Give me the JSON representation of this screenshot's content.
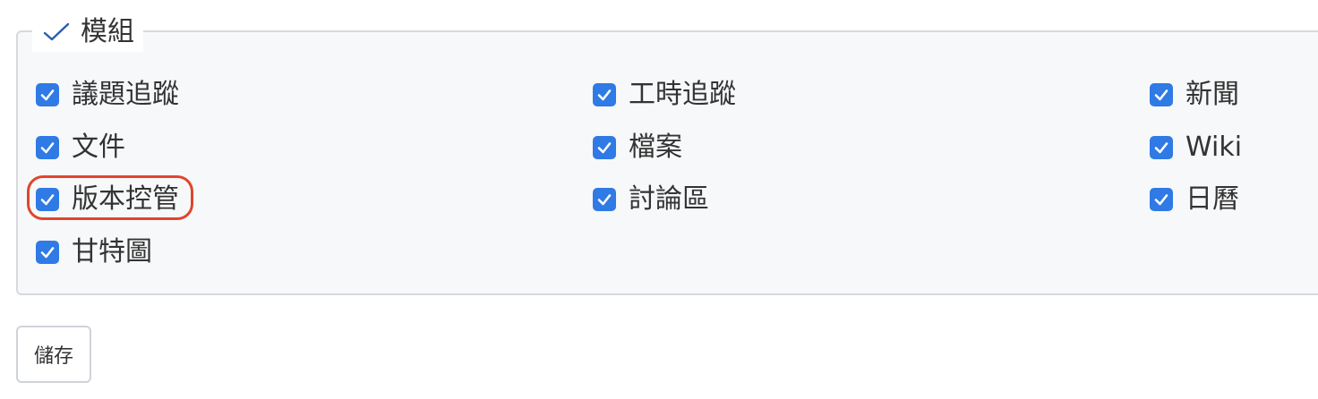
{
  "fieldset": {
    "legend": "模組",
    "options": [
      {
        "label": "議題追蹤",
        "checked": true
      },
      {
        "label": "工時追蹤",
        "checked": true
      },
      {
        "label": "新聞",
        "checked": true
      },
      {
        "label": "文件",
        "checked": true
      },
      {
        "label": "檔案",
        "checked": true
      },
      {
        "label": "Wiki",
        "checked": true
      },
      {
        "label": "版本控管",
        "checked": true
      },
      {
        "label": "討論區",
        "checked": true
      },
      {
        "label": "日曆",
        "checked": true
      },
      {
        "label": "甘特圖",
        "checked": true
      }
    ]
  },
  "actions": {
    "save_label": "儲存"
  },
  "colors": {
    "checkbox": "#2f7ae5",
    "highlight": "#e0452d"
  },
  "icons": {
    "legend": "check-icon",
    "checkbox": "checkmark-icon"
  }
}
